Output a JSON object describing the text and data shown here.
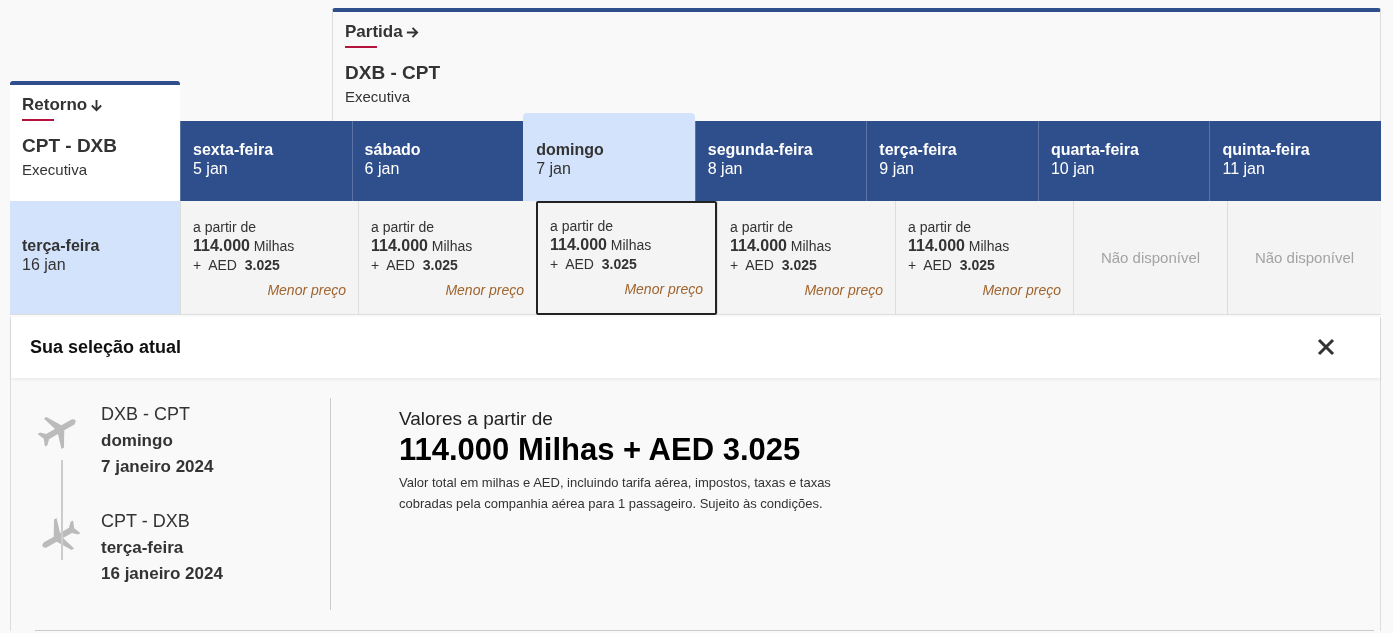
{
  "return_tab": {
    "label": "Retorno",
    "route": "CPT - DXB",
    "cabin": "Executiva"
  },
  "outbound_tab": {
    "label": "Partida",
    "route": "DXB - CPT",
    "cabin": "Executiva"
  },
  "return_date": {
    "day": "terça-feira",
    "date": "16 jan",
    "selected": true
  },
  "outbound_dates": [
    {
      "day": "sexta-feira",
      "date": "5 jan",
      "selected": false,
      "fare": {
        "kind": "price",
        "prefix": "a partir de",
        "miles": "**114.000** Milhas",
        "cash": "+  AED  **3.025**",
        "tag": "Menor preço"
      }
    },
    {
      "day": "sábado",
      "date": "6 jan",
      "selected": false,
      "fare": {
        "kind": "price",
        "prefix": "a partir de",
        "miles": "**114.000** Milhas",
        "cash": "+  AED  **3.025**",
        "tag": "Menor preço"
      }
    },
    {
      "day": "domingo",
      "date": "7 jan",
      "selected": true,
      "fare": {
        "kind": "price",
        "prefix": "a partir de",
        "miles": "**114.000** Milhas",
        "cash": "+  AED  **3.025**",
        "tag": "Menor preço"
      }
    },
    {
      "day": "segunda-feira",
      "date": "8 jan",
      "selected": false,
      "fare": {
        "kind": "price",
        "prefix": "a partir de",
        "miles": "**114.000** Milhas",
        "cash": "+  AED  **3.025**",
        "tag": "Menor preço"
      }
    },
    {
      "day": "terça-feira",
      "date": "9 jan",
      "selected": false,
      "fare": {
        "kind": "price",
        "prefix": "a partir de",
        "miles": "**114.000** Milhas",
        "cash": "+  AED  **3.025**",
        "tag": "Menor preço"
      }
    },
    {
      "day": "quarta-feira",
      "date": "10 jan",
      "selected": false,
      "fare": {
        "kind": "unavailable",
        "text": "Não disponível"
      }
    },
    {
      "day": "quinta-feira",
      "date": "11 jan",
      "selected": false,
      "fare": {
        "kind": "unavailable",
        "text": "Não disponível"
      }
    }
  ],
  "selection": {
    "title": "Sua seleção atual",
    "flights": [
      {
        "kind": "departure",
        "route": "DXB - CPT",
        "day": "domingo",
        "date": "7 janeiro 2024"
      },
      {
        "kind": "arrival",
        "route": "CPT - DXB",
        "day": "terça-feira",
        "date": "16 janeiro 2024"
      }
    ],
    "price_label": "Valores a partir de",
    "total": "114.000 Milhas + AED 3.025",
    "note": "Valor total em milhas e AED, incluindo tarifa aérea, impostos, taxas e taxas cobradas pela companhia aérea para 1 passageiro. Sujeito às condições."
  }
}
